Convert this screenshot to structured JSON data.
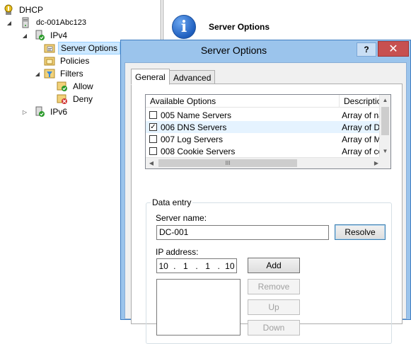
{
  "tree": {
    "items": [
      {
        "label": "DHCP",
        "icon": "dhcp-server-icon"
      },
      {
        "label": "dc-001Abc123",
        "icon": "server-tower-icon"
      },
      {
        "label": "IPv4",
        "icon": "ipv4-check-icon"
      },
      {
        "label": "Server Options",
        "icon": "options-folder-icon"
      },
      {
        "label": "Policies",
        "icon": "policies-folder-icon"
      },
      {
        "label": "Filters",
        "icon": "filters-funnel-icon"
      },
      {
        "label": "Allow",
        "icon": "allow-filter-icon"
      },
      {
        "label": "Deny",
        "icon": "deny-filter-icon"
      },
      {
        "label": "IPv6",
        "icon": "ipv6-check-icon"
      }
    ]
  },
  "right_pane": {
    "title": "Server Options",
    "icon": "info-icon"
  },
  "dialog": {
    "title": "Server Options",
    "help_label": "?",
    "close_label": "✕",
    "tabs": [
      {
        "label": "General",
        "active": true
      },
      {
        "label": "Advanced",
        "active": false
      }
    ],
    "options_list": {
      "headers": [
        "Available Options",
        "Description"
      ],
      "rows": [
        {
          "checked": false,
          "name": "005 Name Servers",
          "description": "Array of nam"
        },
        {
          "checked": true,
          "name": "006 DNS Servers",
          "description": "Array of DNS"
        },
        {
          "checked": false,
          "name": "007 Log Servers",
          "description": "Array of MIT"
        },
        {
          "checked": false,
          "name": "008 Cookie Servers",
          "description": "Array of coo"
        }
      ],
      "hscroll_grip": "III"
    },
    "data_entry": {
      "legend": "Data entry",
      "server_name_label": "Server name:",
      "server_name_value": "DC-001",
      "resolve_label": "Resolve",
      "ip_label": "IP address:",
      "ip_octets": [
        "10",
        "1",
        "1",
        "10"
      ],
      "add_label": "Add",
      "remove_label": "Remove",
      "up_label": "Up",
      "down_label": "Down"
    }
  },
  "colors": {
    "dialog_frame": "#9bc4ec",
    "close_button": "#c75050",
    "info_icon": "#1f5fbf",
    "selection": "#cce8ff"
  }
}
